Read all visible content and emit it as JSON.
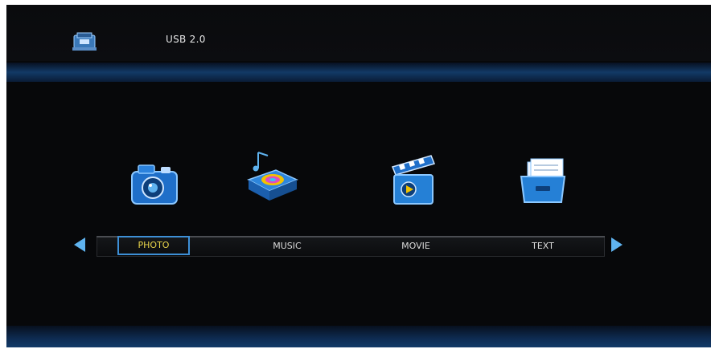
{
  "header": {
    "device_label": "USB 2.0",
    "device_icon": "usb-drive-icon"
  },
  "menu": {
    "items": [
      {
        "label": "PHOTO",
        "icon": "camera-icon",
        "selected": true
      },
      {
        "label": "MUSIC",
        "icon": "music-box-icon",
        "selected": false
      },
      {
        "label": "MOVIE",
        "icon": "clapperboard-icon",
        "selected": false
      },
      {
        "label": "TEXT",
        "icon": "text-folder-icon",
        "selected": false
      }
    ]
  },
  "colors": {
    "background": "#07080a",
    "accent_blue": "#5fb3ef",
    "selected_text": "#e8d44a",
    "band_blue": "#123a66"
  }
}
